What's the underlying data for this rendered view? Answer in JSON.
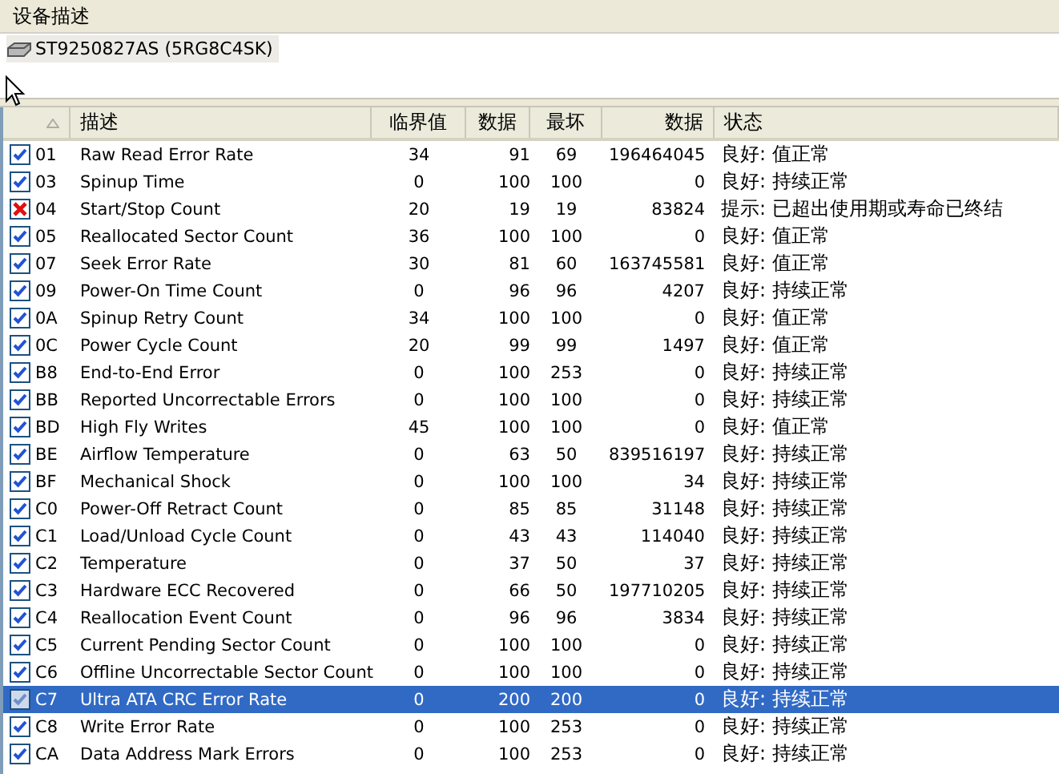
{
  "section_title": "设备描述",
  "device": {
    "label": "ST9250827AS (5RG8C4SK)",
    "selected": true
  },
  "table": {
    "columns": [
      {
        "sorted": true
      },
      {
        "label": "描述"
      },
      {
        "label": "临界值"
      },
      {
        "label": "数据"
      },
      {
        "label": "最坏"
      },
      {
        "label": "数据"
      },
      {
        "label": "状态"
      }
    ],
    "rows": [
      {
        "kind": "ok",
        "id": "01",
        "name": "Raw Read Error Rate",
        "threshold": "34",
        "value": "91",
        "worst": "69",
        "raw": "196464045",
        "status": "良好: 值正常",
        "selected": false
      },
      {
        "kind": "ok",
        "id": "03",
        "name": "Spinup Time",
        "threshold": "0",
        "value": "100",
        "worst": "100",
        "raw": "0",
        "status": "良好: 持续正常",
        "selected": false
      },
      {
        "kind": "fail",
        "id": "04",
        "name": "Start/Stop Count",
        "threshold": "20",
        "value": "19",
        "worst": "19",
        "raw": "83824",
        "status": "提示: 已超出使用期或寿命已终结",
        "selected": false
      },
      {
        "kind": "ok",
        "id": "05",
        "name": "Reallocated Sector Count",
        "threshold": "36",
        "value": "100",
        "worst": "100",
        "raw": "0",
        "status": "良好: 值正常",
        "selected": false
      },
      {
        "kind": "ok",
        "id": "07",
        "name": "Seek Error Rate",
        "threshold": "30",
        "value": "81",
        "worst": "60",
        "raw": "163745581",
        "status": "良好: 值正常",
        "selected": false
      },
      {
        "kind": "ok",
        "id": "09",
        "name": "Power-On Time Count",
        "threshold": "0",
        "value": "96",
        "worst": "96",
        "raw": "4207",
        "status": "良好: 持续正常",
        "selected": false
      },
      {
        "kind": "ok",
        "id": "0A",
        "name": "Spinup Retry Count",
        "threshold": "34",
        "value": "100",
        "worst": "100",
        "raw": "0",
        "status": "良好: 值正常",
        "selected": false
      },
      {
        "kind": "ok",
        "id": "0C",
        "name": "Power Cycle Count",
        "threshold": "20",
        "value": "99",
        "worst": "99",
        "raw": "1497",
        "status": "良好: 值正常",
        "selected": false
      },
      {
        "kind": "ok",
        "id": "B8",
        "name": "End-to-End Error",
        "threshold": "0",
        "value": "100",
        "worst": "253",
        "raw": "0",
        "status": "良好: 持续正常",
        "selected": false
      },
      {
        "kind": "ok",
        "id": "BB",
        "name": "Reported Uncorrectable Errors",
        "threshold": "0",
        "value": "100",
        "worst": "100",
        "raw": "0",
        "status": "良好: 持续正常",
        "selected": false
      },
      {
        "kind": "ok",
        "id": "BD",
        "name": "High Fly Writes",
        "threshold": "45",
        "value": "100",
        "worst": "100",
        "raw": "0",
        "status": "良好: 值正常",
        "selected": false
      },
      {
        "kind": "ok",
        "id": "BE",
        "name": "Airflow Temperature",
        "threshold": "0",
        "value": "63",
        "worst": "50",
        "raw": "839516197",
        "status": "良好: 持续正常",
        "selected": false
      },
      {
        "kind": "ok",
        "id": "BF",
        "name": "Mechanical Shock",
        "threshold": "0",
        "value": "100",
        "worst": "100",
        "raw": "34",
        "status": "良好: 持续正常",
        "selected": false
      },
      {
        "kind": "ok",
        "id": "C0",
        "name": "Power-Off Retract Count",
        "threshold": "0",
        "value": "85",
        "worst": "85",
        "raw": "31148",
        "status": "良好: 持续正常",
        "selected": false
      },
      {
        "kind": "ok",
        "id": "C1",
        "name": "Load/Unload Cycle Count",
        "threshold": "0",
        "value": "43",
        "worst": "43",
        "raw": "114040",
        "status": "良好: 持续正常",
        "selected": false
      },
      {
        "kind": "ok",
        "id": "C2",
        "name": "Temperature",
        "threshold": "0",
        "value": "37",
        "worst": "50",
        "raw": "37",
        "status": "良好: 持续正常",
        "selected": false
      },
      {
        "kind": "ok",
        "id": "C3",
        "name": "Hardware ECC Recovered",
        "threshold": "0",
        "value": "66",
        "worst": "50",
        "raw": "197710205",
        "status": "良好: 持续正常",
        "selected": false
      },
      {
        "kind": "ok",
        "id": "C4",
        "name": "Reallocation Event Count",
        "threshold": "0",
        "value": "96",
        "worst": "96",
        "raw": "3834",
        "status": "良好: 持续正常",
        "selected": false
      },
      {
        "kind": "ok",
        "id": "C5",
        "name": "Current Pending Sector Count",
        "threshold": "0",
        "value": "100",
        "worst": "100",
        "raw": "0",
        "status": "良好: 持续正常",
        "selected": false
      },
      {
        "kind": "ok",
        "id": "C6",
        "name": "Offline Uncorrectable Sector Count",
        "threshold": "0",
        "value": "100",
        "worst": "100",
        "raw": "0",
        "status": "良好: 持续正常",
        "selected": false
      },
      {
        "kind": "ok",
        "id": "C7",
        "name": "Ultra ATA CRC Error Rate",
        "threshold": "0",
        "value": "200",
        "worst": "200",
        "raw": "0",
        "status": "良好: 持续正常",
        "selected": true
      },
      {
        "kind": "ok",
        "id": "C8",
        "name": "Write Error Rate",
        "threshold": "0",
        "value": "100",
        "worst": "253",
        "raw": "0",
        "status": "良好: 持续正常",
        "selected": false
      },
      {
        "kind": "ok",
        "id": "CA",
        "name": "Data Address Mark Errors",
        "threshold": "0",
        "value": "100",
        "worst": "253",
        "raw": "0",
        "status": "良好: 持续正常",
        "selected": false
      }
    ]
  }
}
